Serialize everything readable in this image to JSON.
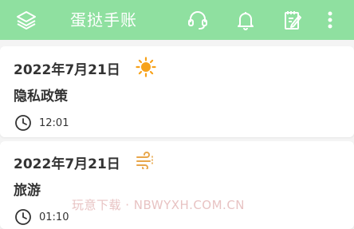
{
  "header": {
    "title": "蛋挞手账",
    "icons": [
      "layers-icon",
      "headset-icon",
      "bell-icon",
      "edit-note-icon",
      "more-vert-icon"
    ],
    "accent_color": "#8fe0a0"
  },
  "entries": [
    {
      "date": "2022年7月21日",
      "weather_icon": "sun-icon",
      "title": "隐私政策",
      "time": "12:01"
    },
    {
      "date": "2022年7月21日",
      "weather_icon": "wind-icon",
      "title": "旅游",
      "time": "01:10"
    }
  ],
  "watermark": "玩意下载 · NBWYXH.COM.CN"
}
